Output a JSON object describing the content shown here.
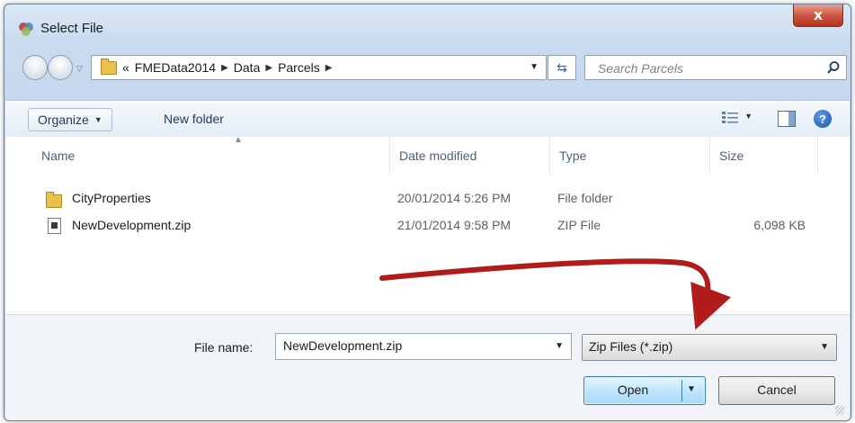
{
  "window": {
    "title": "Select File",
    "close_label": "x"
  },
  "address_bar": {
    "overflow": "«",
    "breadcrumbs": [
      "FMEData2014",
      "Data",
      "Parcels"
    ]
  },
  "search": {
    "placeholder": "Search Parcels"
  },
  "toolbar": {
    "organize_label": "Organize",
    "new_folder_label": "New folder"
  },
  "columns": {
    "name": "Name",
    "date": "Date modified",
    "type": "Type",
    "size": "Size"
  },
  "files": [
    {
      "name": "CityProperties",
      "date": "20/01/2014 5:26 PM",
      "type": "File folder",
      "size": "",
      "icon": "folder-icon"
    },
    {
      "name": "NewDevelopment.zip",
      "date": "21/01/2014 9:58 PM",
      "type": "ZIP File",
      "size": "6,098 KB",
      "icon": "zip-file-icon"
    }
  ],
  "footer": {
    "file_name_label": "File name:",
    "file_name_value": "NewDevelopment.zip",
    "file_type": "Zip Files (*.zip)",
    "open_label": "Open",
    "cancel_label": "Cancel"
  },
  "colors": {
    "annotation_arrow": "#b01c1c",
    "accent": "#3c7fb1"
  }
}
